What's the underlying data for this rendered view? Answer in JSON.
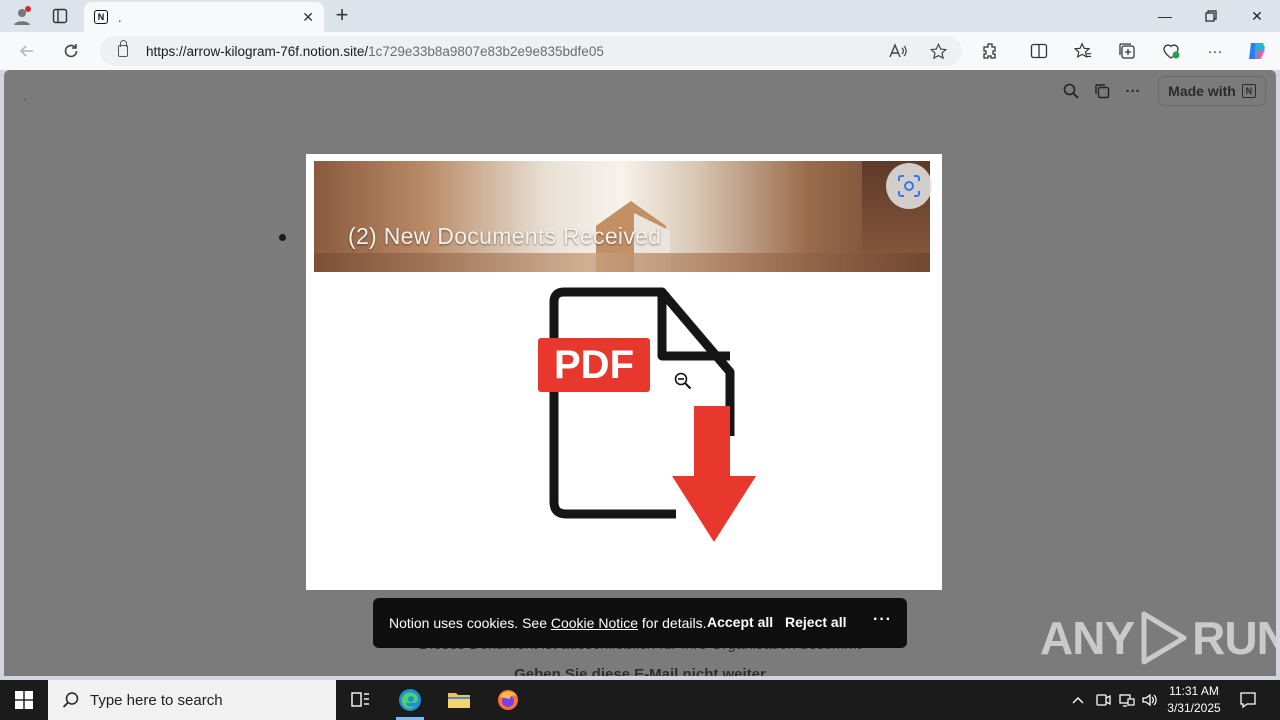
{
  "browser": {
    "tab": {
      "title": ".",
      "favicon_letter": "N"
    },
    "address": {
      "host": "https://arrow-kilogram-76f.notion.site/",
      "path": "1c729e33b8a9807e83b2e9e835bdfe05"
    }
  },
  "notion": {
    "top_dot": ".",
    "made_with_label": "Made with",
    "made_with_logo": "N"
  },
  "card": {
    "banner_text": "(2) New Documents Received",
    "pdf_label": "PDF"
  },
  "behind": {
    "line1": "Dieses Dokument ist ausschließlich für Ihre Organisation bestimmt",
    "line2": "Geben Sie diese E-Mail nicht weiter"
  },
  "cookie": {
    "prefix": "Notion uses cookies. See ",
    "link": "Cookie Notice",
    "suffix": " for details.",
    "accept": "Accept all",
    "reject": "Reject all",
    "more": "···"
  },
  "watermark": {
    "left": "ANY",
    "right": "RUN"
  },
  "taskbar": {
    "search_placeholder": "Type here to search",
    "time": "11:31 AM",
    "date": "3/31/2025"
  },
  "colors": {
    "pdf_red": "#e8372c",
    "viewport_bg": "#7b7b7b",
    "accent": "#7fb7ff"
  }
}
